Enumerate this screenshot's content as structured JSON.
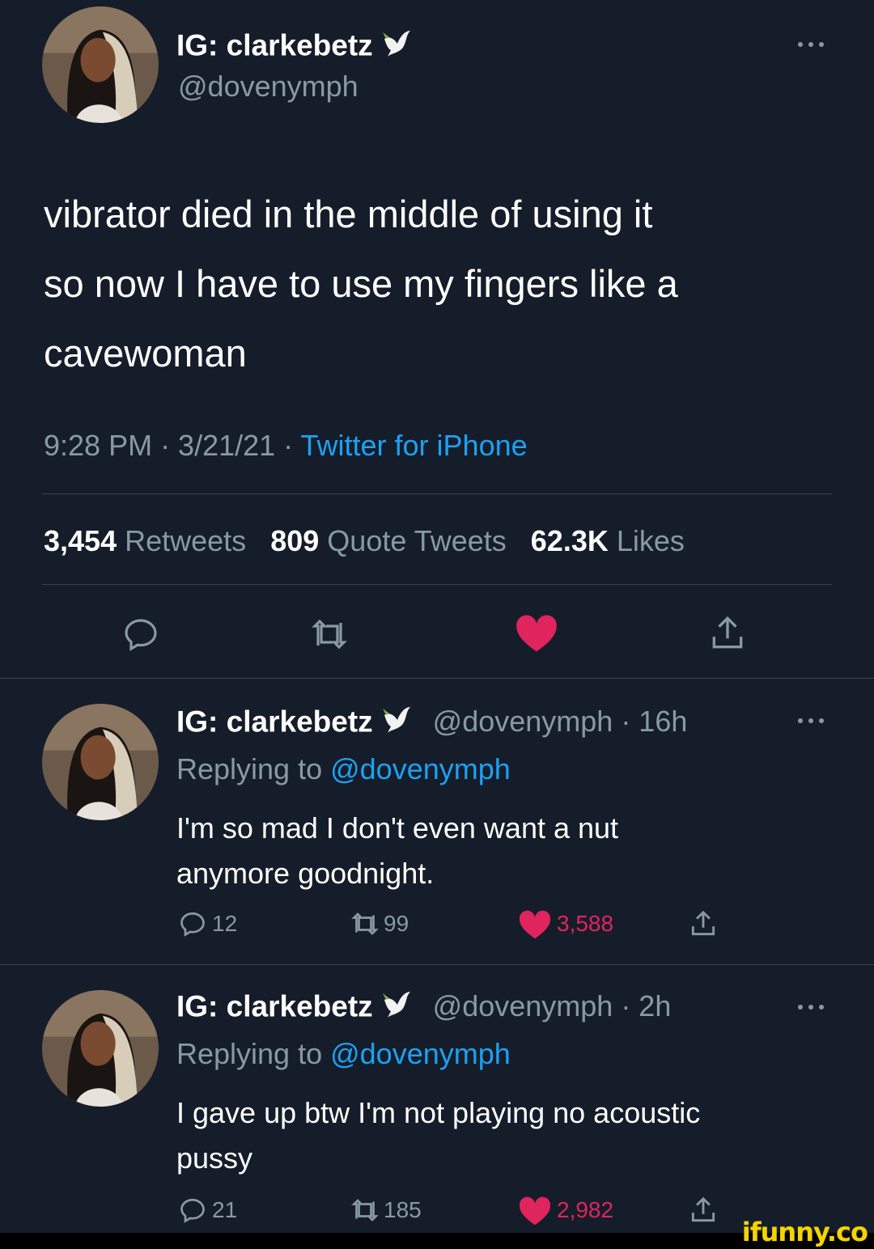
{
  "main_tweet": {
    "display_name": "IG: clarkebetz",
    "handle": "@dovenymph",
    "text_lines": [
      "vibrator died in the middle of using it",
      "so now I have to use my fingers like a",
      "cavewoman"
    ],
    "timestamp": "9:28 PM · 3/21/21 · ",
    "source": "Twitter for iPhone",
    "retweets": "3,454",
    "retweets_label": "Retweets",
    "quotes": "809",
    "quotes_label": "Quote Tweets",
    "likes": "62.3K",
    "likes_label": "Likes"
  },
  "replies": [
    {
      "display_name": "IG: clarkebetz",
      "handle_time": "@dovenymph · 16h",
      "replying_prefix": "Replying to ",
      "replying_to": "@dovenymph",
      "text_lines": [
        "I'm so mad I don't even want a nut",
        "anymore goodnight."
      ],
      "replies": "12",
      "retweets": "99",
      "likes": "3,588"
    },
    {
      "display_name": "IG: clarkebetz",
      "handle_time": "@dovenymph · 2h",
      "replying_prefix": "Replying to ",
      "replying_to": "@dovenymph",
      "text_lines": [
        "I gave up btw I'm not playing no acoustic",
        "pussy"
      ],
      "replies": "21",
      "retweets": "185",
      "likes": "2,982"
    }
  ],
  "watermark": "ifunny.co",
  "colors": {
    "background": "#151d2a",
    "secondary_text": "#8899a6",
    "link": "#1da1f2",
    "like": "#e0245e",
    "divider": "#38444d"
  },
  "icons": [
    "reply-icon",
    "retweet-icon",
    "like-icon",
    "share-icon",
    "dove-icon",
    "more-icon"
  ]
}
